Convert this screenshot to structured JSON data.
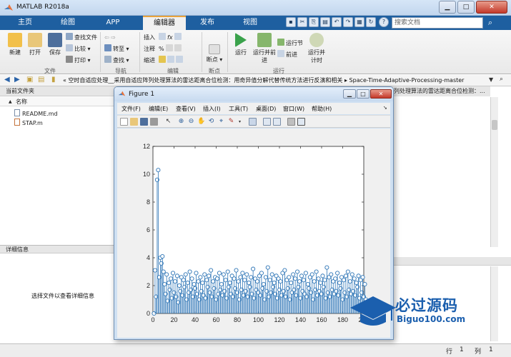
{
  "window": {
    "title": "MATLAB R2018a",
    "help_label": "?"
  },
  "tabs": [
    {
      "label": "主页"
    },
    {
      "label": "绘图"
    },
    {
      "label": "APP"
    },
    {
      "label": "编辑器"
    },
    {
      "label": "发布"
    },
    {
      "label": "视图"
    }
  ],
  "search": {
    "placeholder": "搜索文档"
  },
  "ribbon": {
    "file_group": {
      "label": "文件",
      "new": "新建",
      "open": "打开",
      "save": "保存",
      "find_files": "查找文件",
      "compare": "比较",
      "print": "打印"
    },
    "nav_group": {
      "label": "导航",
      "goto": "转至",
      "find": "查找"
    },
    "edit_group": {
      "label": "编辑",
      "insert": "插入",
      "comment": "注释",
      "indent": "缩进",
      "fx": "fx",
      "percent": "%"
    },
    "breakpoint_group": {
      "label": "断点",
      "breakpoints": "断点"
    },
    "run_group": {
      "label": "运行",
      "run": "运行",
      "run_advance": "运行并前进",
      "run_section": "运行节",
      "advance": "前进",
      "run_time": "运行并计时"
    }
  },
  "address": {
    "path": "«  空时自适应处理__采用自适应阵列处理算法的雷达距离合位检测：用奇异值分解代替传统方法进行反演和相关  ▸  Space-Time-Adaptive-Processing-master"
  },
  "current_folder": {
    "title": "当前文件夹",
    "column_name": "名称",
    "sort_arrow": "▲",
    "files": [
      "README.md",
      "STAP.m"
    ]
  },
  "details": {
    "title": "详细信息",
    "message": "选择文件以查看详细信息"
  },
  "right_panel": {
    "header": "列处理算法的雷达距离合位检测：..."
  },
  "status": {
    "row_label": "行",
    "row_value": "1",
    "col_label": "列",
    "col_value": "1"
  },
  "figure": {
    "title": "Figure 1",
    "menu": [
      "文件(F)",
      "编辑(E)",
      "查看(V)",
      "插入(I)",
      "工具(T)",
      "桌面(D)",
      "窗口(W)",
      "帮助(H)"
    ]
  },
  "watermark": {
    "cn": "必过源码",
    "en": "Biguo100.com"
  },
  "colors": {
    "accent": "#1e5fa0",
    "stem": "#2e75b6",
    "active_tab_line": "#e8a33c"
  },
  "chart_data": {
    "type": "stem",
    "xlim": [
      0,
      200
    ],
    "ylim": [
      0,
      12
    ],
    "xticks": [
      0,
      20,
      40,
      60,
      80,
      100,
      120,
      140,
      160,
      180,
      200
    ],
    "yticks": [
      0,
      2,
      4,
      6,
      8,
      10,
      12
    ],
    "grid": false,
    "x_start": 1,
    "values": [
      0.0,
      3.1,
      1.2,
      9.6,
      10.3,
      2.6,
      4.0,
      3.6,
      4.1,
      3.0,
      2.1,
      1.4,
      2.8,
      0.9,
      2.2,
      1.7,
      2.5,
      1.1,
      2.9,
      1.5,
      2.3,
      1.2,
      2.7,
      0.8,
      2.0,
      1.6,
      2.6,
      1.3,
      2.4,
      1.9,
      2.8,
      1.0,
      2.2,
      1.5,
      3.0,
      1.7,
      2.5,
      1.2,
      2.1,
      1.8,
      2.9,
      1.4,
      2.3,
      1.0,
      2.6,
      1.6,
      2.2,
      1.3,
      2.8,
      1.1,
      2.4,
      1.9,
      2.7,
      1.5,
      3.1,
      1.2,
      2.3,
      1.8,
      2.6,
      1.0,
      2.5,
      1.4,
      2.9,
      1.7,
      2.1,
      1.3,
      2.8,
      1.6,
      2.4,
      1.1,
      3.0,
      1.9,
      2.2,
      1.4,
      2.7,
      1.2,
      2.5,
      1.8,
      3.1,
      1.5,
      2.3,
      1.0,
      2.6,
      1.7,
      2.9,
      1.3,
      2.4,
      1.6,
      2.8,
      1.2,
      2.2,
      1.9,
      2.6,
      1.4,
      3.2,
      1.1,
      2.5,
      1.7,
      2.3,
      1.5,
      2.7,
      1.3,
      2.9,
      1.8,
      2.1,
      1.0,
      2.6,
      1.6,
      3.3,
      1.2,
      2.4,
      1.5,
      2.8,
      1.9,
      2.2,
      1.4,
      2.7,
      1.1,
      2.5,
      1.7,
      2.3,
      1.3,
      2.9,
      1.6,
      3.1,
      1.2,
      2.4,
      1.8,
      2.6,
      1.0,
      2.2,
      1.5,
      2.8,
      1.7,
      2.5,
      1.3,
      3.0,
      1.9,
      2.3,
      1.1,
      2.7,
      1.6,
      2.4,
      1.4,
      2.9,
      1.2,
      2.1,
      1.8,
      2.6,
      1.5,
      2.8,
      1.0,
      2.3,
      1.7,
      3.0,
      1.3,
      2.5,
      1.6,
      2.2,
      1.4,
      2.7,
      1.9,
      2.4,
      1.1,
      3.3,
      1.5,
      2.6,
      1.2,
      2.8,
      1.7,
      2.3,
      1.4,
      2.5,
      1.6,
      2.9,
      1.3,
      2.2,
      1.8,
      2.6,
      1.0,
      2.4,
      1.5,
      2.7,
      1.2,
      3.0,
      1.7,
      2.3,
      1.4,
      2.8,
      1.6,
      2.5,
      1.3,
      2.2,
      1.9,
      2.7,
      1.1,
      2.4,
      1.5,
      2.6,
      1.2,
      2.1,
      1.0
    ]
  }
}
